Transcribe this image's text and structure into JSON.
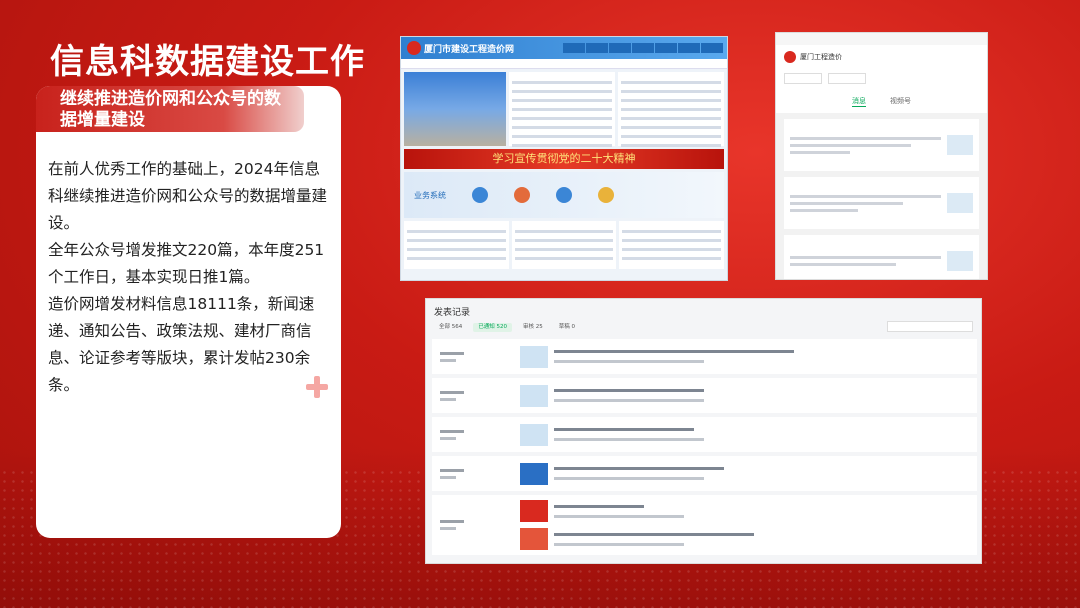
{
  "slide": {
    "title": "信息科数据建设工作",
    "subtitle": "继续推进造价网和公众号的数据增量建设",
    "paragraphs": [
      "在前人优秀工作的基础上，2024年信息科继续推进造价网和公众号的数据增量建设。",
      "全年公众号增发推文220篇，本年度251个工作日，基本实现日推1篇。",
      "造价网增发材料信息18111条，新闻速递、通知公告、政策法规、建材厂商信息、论证参考等版块，累计发帖230余条。"
    ]
  },
  "website_screenshot": {
    "site_name": "厦门市建设工程造价网",
    "banner_text": "学习宣传贯彻党的二十大精神",
    "business_label": "业务系统"
  },
  "account_screenshot": {
    "account_name": "厦门工程造价",
    "tabs": [
      "消息",
      "视频号"
    ]
  },
  "records_screenshot": {
    "title": "发表记录",
    "filters": [
      "全部 564",
      "已通知 520",
      "审核 25",
      "草稿 0"
    ],
    "row_count": 6
  },
  "colors": {
    "background": "#c91b14",
    "accent": "#07a85a"
  }
}
